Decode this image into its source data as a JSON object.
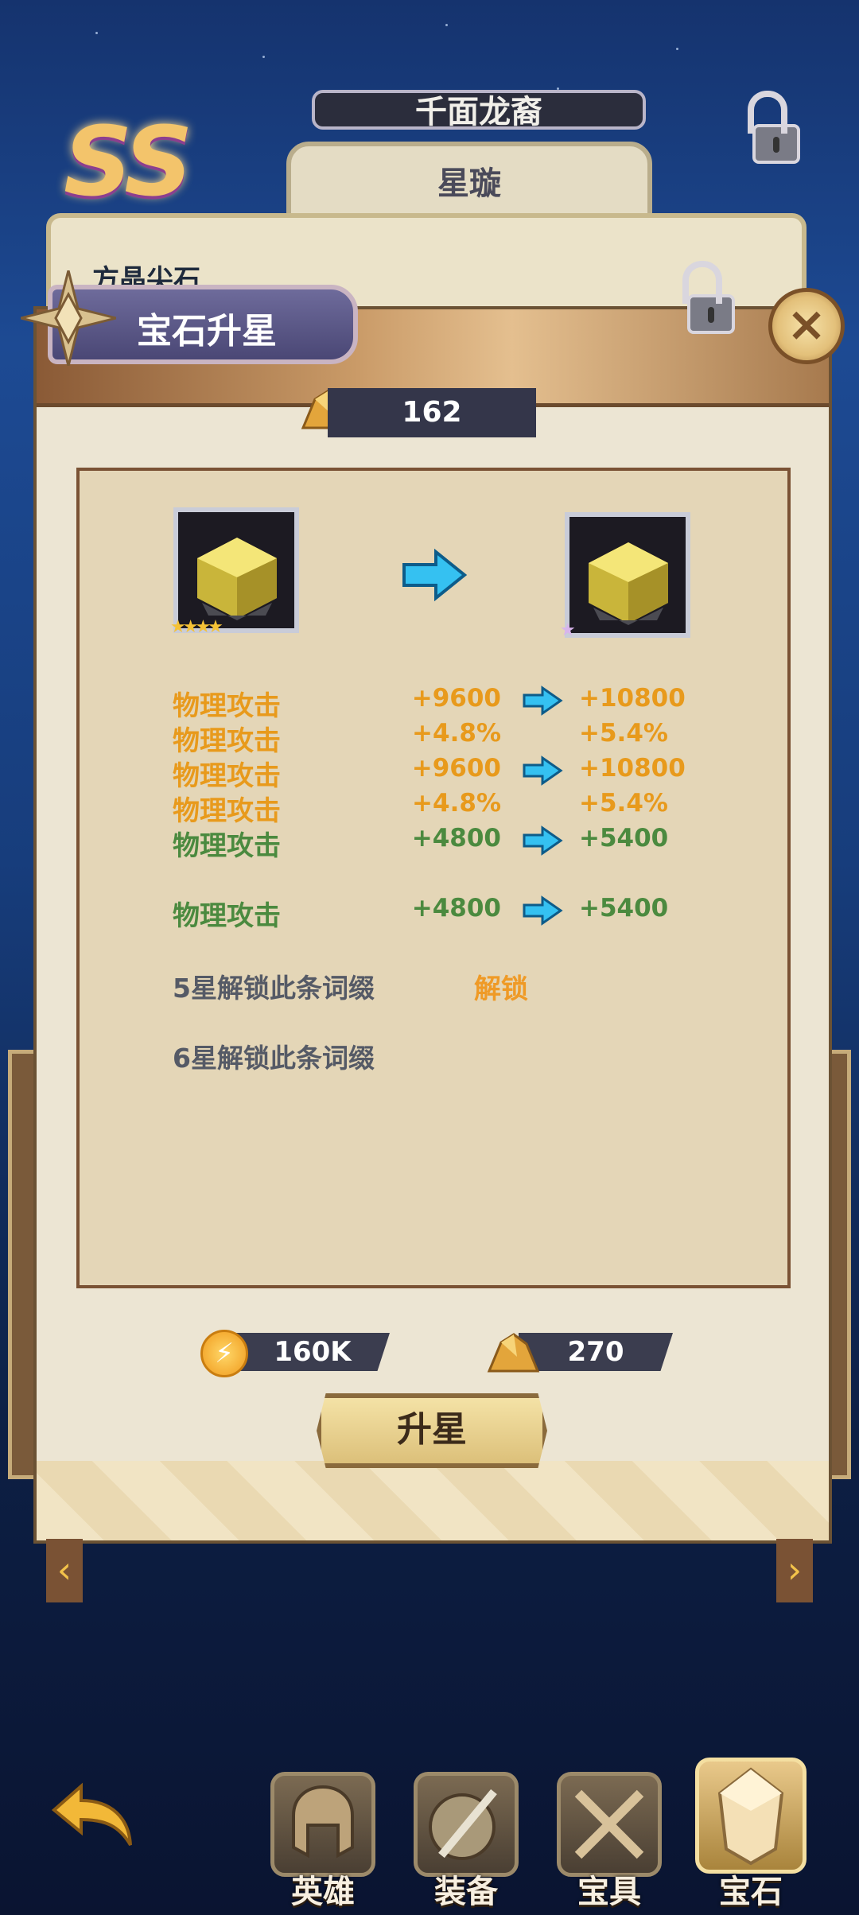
{
  "header": {
    "rank_badge": "SS",
    "hero_name": "千面龙裔",
    "hero_subtitle": "星璇",
    "background_item_label": "方晶尖石"
  },
  "modal": {
    "title": "宝石升星",
    "close_icon": "close-icon",
    "material_count": "162",
    "current_gem_stars": 4,
    "next_gem_stars": 1,
    "stats": [
      {
        "name": "物理攻击",
        "old": "+9600",
        "new": "+10800",
        "color": "orange",
        "arrow": true
      },
      {
        "name": "物理攻击",
        "old": "+4.8%",
        "new": "+5.4%",
        "color": "orange",
        "arrow": false
      },
      {
        "name": "物理攻击",
        "old": "+9600",
        "new": "+10800",
        "color": "orange",
        "arrow": true
      },
      {
        "name": "物理攻击",
        "old": "+4.8%",
        "new": "+5.4%",
        "color": "orange",
        "arrow": false
      },
      {
        "name": "物理攻击",
        "old": "+4800",
        "new": "+5400",
        "color": "green",
        "arrow": true
      },
      {
        "name": "物理攻击",
        "old": "+4800",
        "new": "+5400",
        "color": "green",
        "arrow": true
      }
    ],
    "locked_affixes": [
      {
        "text": "5星解锁此条词缀",
        "action": "解锁"
      },
      {
        "text": "6星解锁此条词缀",
        "action": ""
      }
    ],
    "cost_gold": "160K",
    "cost_ore": "270",
    "upgrade_button": "升星",
    "colors": {
      "orange": "#e89a1c",
      "green": "#4b8a3f"
    }
  },
  "bottom_nav": {
    "back_icon": "back-arrow-icon",
    "tabs": [
      {
        "label": "英雄",
        "icon": "helmet-icon"
      },
      {
        "label": "装备",
        "icon": "shield-sword-icon"
      },
      {
        "label": "宝具",
        "icon": "crossed-swords-icon"
      },
      {
        "label": "宝石",
        "icon": "gem-icon",
        "active": true
      }
    ]
  }
}
